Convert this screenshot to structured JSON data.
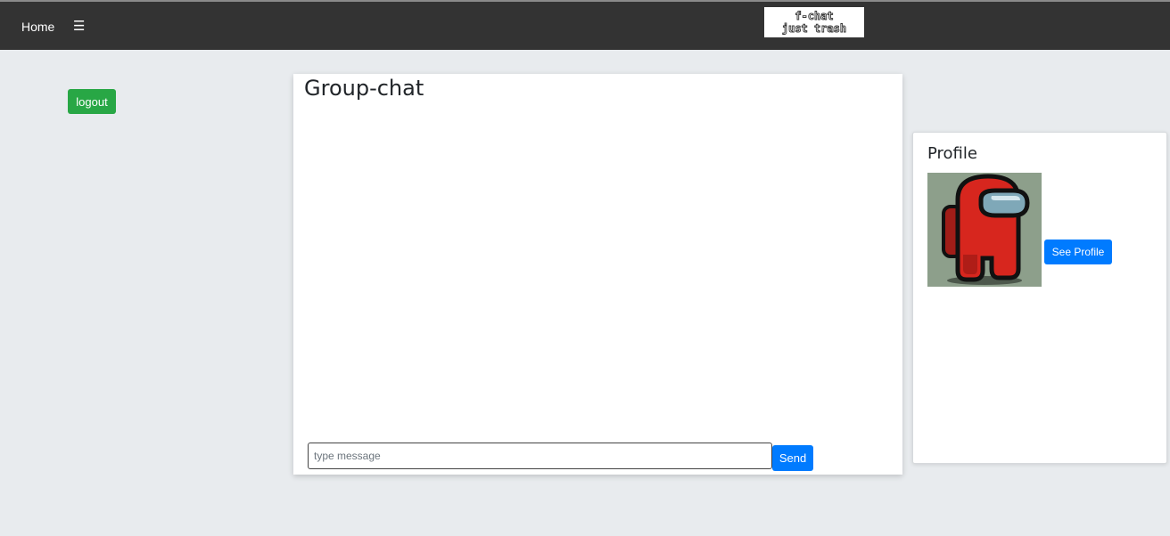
{
  "navbar": {
    "home_label": "Home",
    "menu_icon": "hamburger-icon",
    "menu_glyph": "☰",
    "logo_line1": "f-chat",
    "logo_line2": "just trash"
  },
  "sidebar": {
    "logout_label": "logout"
  },
  "chat": {
    "title": "Group-chat",
    "input_value": "",
    "input_placeholder": "type message",
    "send_label": "Send"
  },
  "profile": {
    "title": "Profile",
    "avatar_icon": "crewmate-avatar",
    "see_profile_label": "See Profile"
  },
  "colors": {
    "navbar_bg": "#333333",
    "page_bg": "#e8ebee",
    "logout_green": "#28a745",
    "primary_blue": "#007bff",
    "avatar_red": "#d7261e"
  }
}
